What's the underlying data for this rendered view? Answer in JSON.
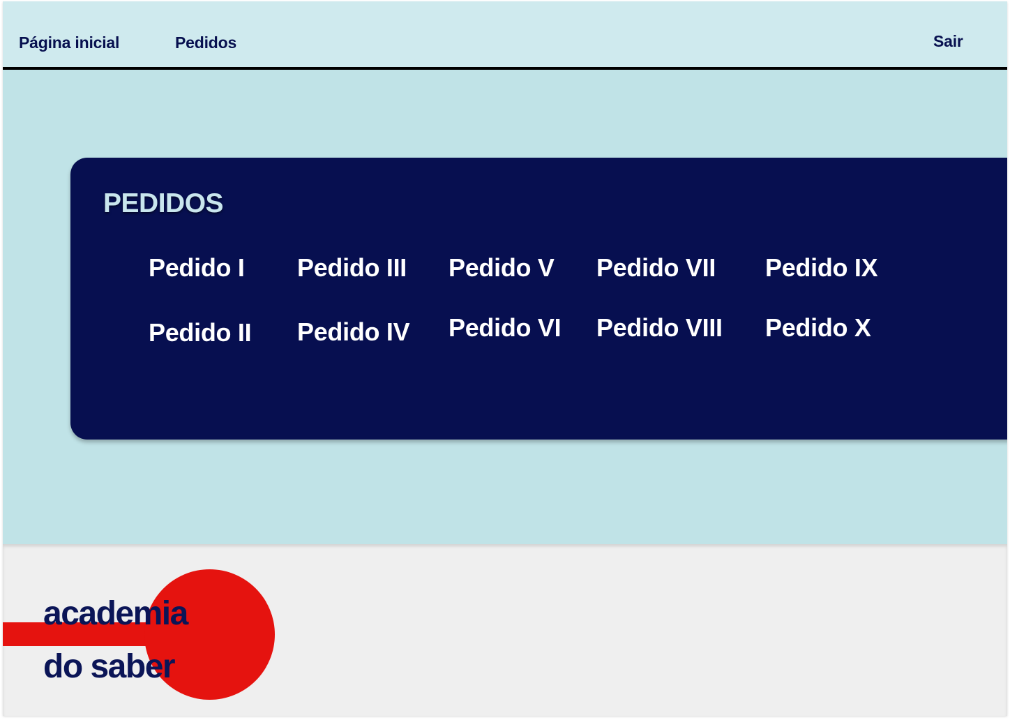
{
  "header": {
    "nav": {
      "home_label": "Página inicial",
      "orders_label": "Pedidos",
      "exit_label": "Sair"
    }
  },
  "orders": {
    "title": "PEDIDOS",
    "items": [
      {
        "label": "Pedido I"
      },
      {
        "label": "Pedido II"
      },
      {
        "label": "Pedido III"
      },
      {
        "label": "Pedido IV"
      },
      {
        "label": "Pedido V"
      },
      {
        "label": "Pedido VI"
      },
      {
        "label": "Pedido VII"
      },
      {
        "label": "Pedido VIII"
      },
      {
        "label": "Pedido IX"
      },
      {
        "label": "Pedido X"
      }
    ]
  },
  "footer": {
    "logo": {
      "line1": "academia",
      "line2": "do saber"
    }
  },
  "colors": {
    "page_background": "#c0e3e7",
    "header_background": "#cfeaee",
    "panel_background": "#070f50",
    "text_navy": "#07104f",
    "logo_red": "#e5130f",
    "footer_background": "#efefef"
  }
}
